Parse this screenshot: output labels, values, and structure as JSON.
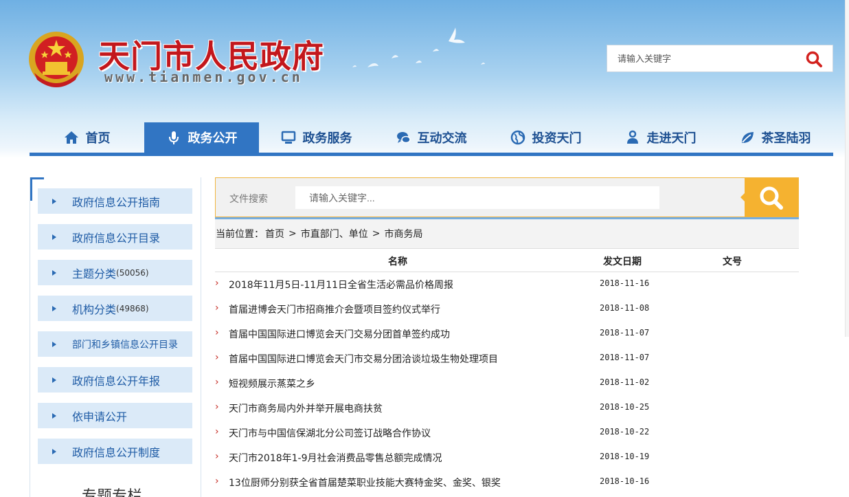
{
  "header": {
    "site_title": "天门市人民政府",
    "site_url": "www.tianmen.gov.cn",
    "search_placeholder": "请输入关键字"
  },
  "nav": {
    "items": [
      {
        "label": "首页",
        "icon": "home-icon"
      },
      {
        "label": "政务公开",
        "icon": "microphone-icon",
        "active": true
      },
      {
        "label": "政务服务",
        "icon": "monitor-icon"
      },
      {
        "label": "互动交流",
        "icon": "chat-icon"
      },
      {
        "label": "投资天门",
        "icon": "globe-icon"
      },
      {
        "label": "走进天门",
        "icon": "person-icon"
      },
      {
        "label": "茶圣陆羽",
        "icon": "leaf-icon"
      }
    ]
  },
  "sidebar": {
    "items": [
      {
        "label": "政府信息公开指南",
        "count": ""
      },
      {
        "label": "政府信息公开目录",
        "count": ""
      },
      {
        "label": "主题分类",
        "count": "(50056)"
      },
      {
        "label": "机构分类",
        "count": "(49868)"
      },
      {
        "label": "部门和乡镇信息公开目录",
        "count": ""
      },
      {
        "label": "政府信息公开年报",
        "count": ""
      },
      {
        "label": "依申请公开",
        "count": ""
      },
      {
        "label": "政府信息公开制度",
        "count": ""
      }
    ],
    "special_title": "专题专栏"
  },
  "file_search": {
    "label": "文件搜索",
    "placeholder": "请输入关键字..."
  },
  "breadcrumb": {
    "prefix": "当前位置：",
    "items": [
      "首页",
      "市直部门、单位",
      "市商务局"
    ],
    "separator": ">"
  },
  "table": {
    "headers": {
      "name": "名称",
      "date": "发文日期",
      "doc_no": "文号"
    },
    "rows": [
      {
        "title": "2018年11月5日-11月11日全省生活必需品价格周报",
        "date": "2018-11-16"
      },
      {
        "title": "首届进博会天门市招商推介会暨项目签约仪式举行",
        "date": "2018-11-08"
      },
      {
        "title": "首届中国国际进口博览会天门交易分团首单签约成功",
        "date": "2018-11-07"
      },
      {
        "title": "首届中国国际进口博览会天门市交易分团洽谈垃圾生物处理项目",
        "date": "2018-11-07"
      },
      {
        "title": "短视频展示蒸菜之乡",
        "date": "2018-11-02"
      },
      {
        "title": "天门市商务局内外并举开展电商扶贫",
        "date": "2018-10-25"
      },
      {
        "title": "天门市与中国信保湖北分公司签订战略合作协议",
        "date": "2018-10-22"
      },
      {
        "title": "天门市2018年1-9月社会消费品零售总额完成情况",
        "date": "2018-10-19"
      },
      {
        "title": "13位厨师分别获全省首届楚菜职业技能大赛特金奖、金奖、银奖",
        "date": "2018-10-16"
      }
    ]
  },
  "colors": {
    "brand_red": "#c3171c",
    "nav_blue": "#3175c3",
    "search_orange": "#f5b230"
  }
}
